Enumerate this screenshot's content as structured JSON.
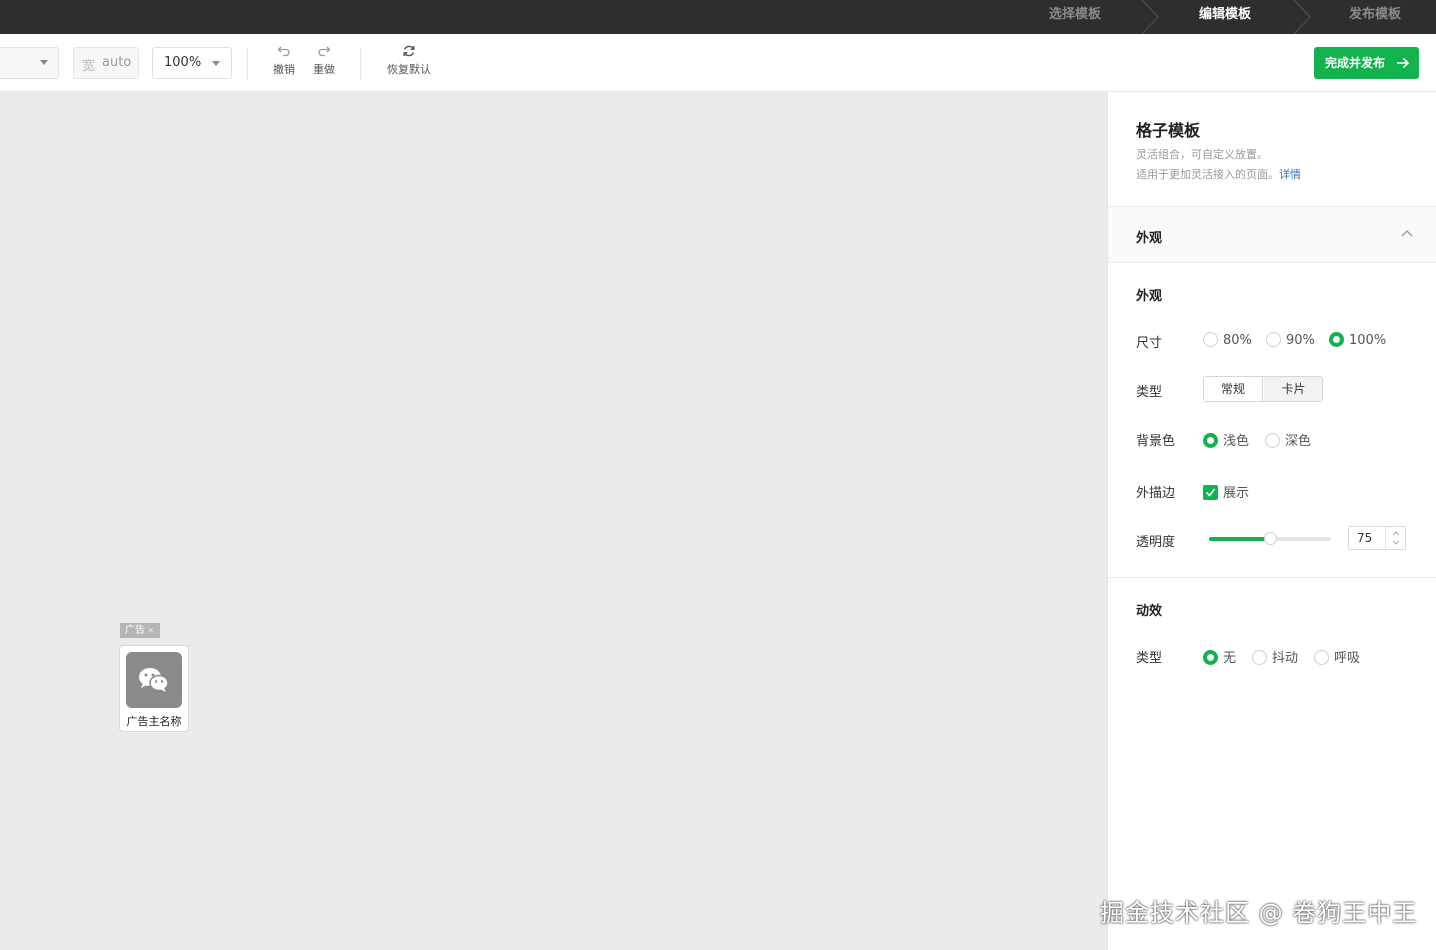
{
  "steps": [
    {
      "label": "选择模板",
      "active": false
    },
    {
      "label": "编辑模板",
      "active": true
    },
    {
      "label": "发布模板",
      "active": false
    }
  ],
  "toolbar": {
    "width_label": "宽",
    "width_value": "auto",
    "zoom_value": "100%",
    "undo_label": "撤销",
    "redo_label": "重做",
    "reset_label": "恢复默认",
    "publish_label": "完成并发布"
  },
  "canvas": {
    "ad_tag": "广告",
    "ad_tag_close": "×",
    "ad_name": "广告主名称"
  },
  "panel": {
    "title": "格子模板",
    "desc_line1": "灵活组合，可自定义放置。",
    "desc_line2": "适用于更加灵活接入的页面。",
    "desc_link": "详情",
    "section_title": "外观",
    "appearance_title": "外观",
    "size_label": "尺寸",
    "size_options": [
      "80%",
      "90%",
      "100%"
    ],
    "size_selected": "100%",
    "type_label": "类型",
    "type_options": [
      "常规",
      "卡片"
    ],
    "type_selected": "卡片",
    "bg_label": "背景色",
    "bg_options": [
      "浅色",
      "深色"
    ],
    "bg_selected": "浅色",
    "border_label": "外描边",
    "border_checkbox": "展示",
    "opacity_label": "透明度",
    "opacity_value": "75",
    "opacity_fraction": 0.5,
    "motion_title": "动效",
    "motion_type_label": "类型",
    "motion_options": [
      "无",
      "抖动",
      "呼吸"
    ],
    "motion_selected": "无"
  },
  "colors": {
    "accent": "#12b24e",
    "link": "#2a78c5",
    "topbar": "#2e2e2e",
    "canvas_bg": "#ebebeb"
  },
  "watermark": "掘金技术社区 @ 卷狗王中王"
}
